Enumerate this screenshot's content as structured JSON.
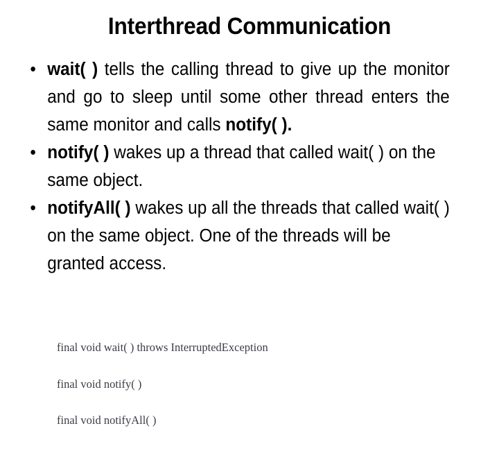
{
  "slide": {
    "title": "Interthread Communication",
    "background_color": "#ffffff",
    "text_color": "#000000",
    "bullet_marker": "•"
  },
  "bullets": [
    {
      "marker": "•",
      "lead_bold": "wait( )",
      "text_after": " tells the calling thread to give up the monitor and go to sleep until some other thread enters the same monitor and calls ",
      "trailing_bold": "notify( ).",
      "full_text": "wait( ) tells the calling thread to give up the monitor and go to sleep until some other thread enters the same monitor and calls notify( )."
    },
    {
      "marker": "•",
      "lead_bold": "notify( )",
      "text_after": " wakes up a thread that called wait( ) on the same object.",
      "trailing_bold": "",
      "full_text": "notify( ) wakes up a thread that called wait( ) on the same object."
    },
    {
      "marker": "•",
      "lead_bold": "notifyAll( )",
      "text_after": " wakes up all the threads that called wait( ) on the same object. One of the threads will be granted access.",
      "trailing_bold": "",
      "full_text": "notifyAll( ) wakes up all the threads that called wait( ) on the same object. One of the threads will be granted access."
    }
  ],
  "code_block": {
    "color": "#3c3c46",
    "lines": [
      "final void wait( ) throws InterruptedException",
      "final void notify( )",
      "final void notifyAll( )"
    ]
  }
}
